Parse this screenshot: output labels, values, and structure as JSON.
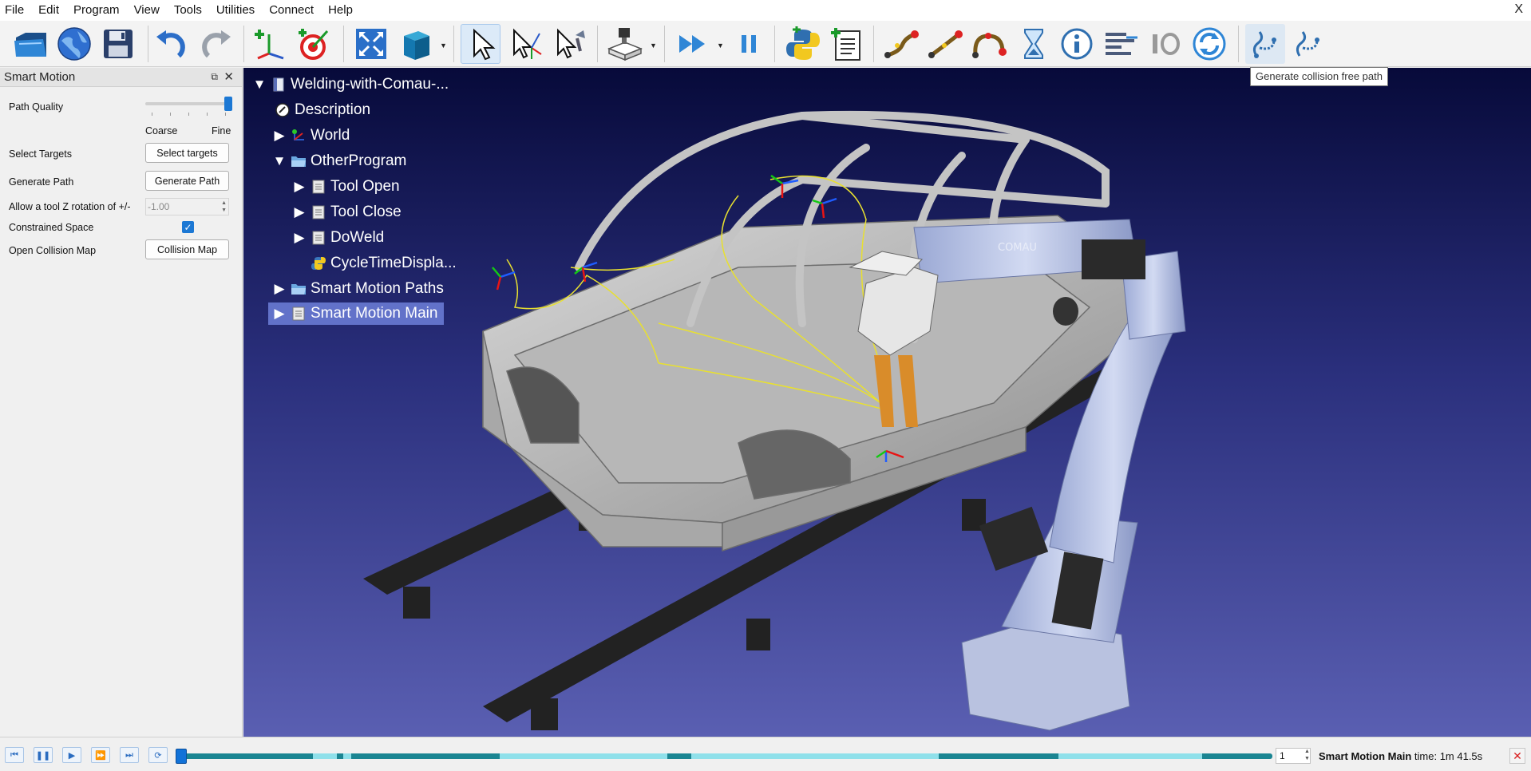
{
  "menu": [
    "File",
    "Edit",
    "Program",
    "View",
    "Tools",
    "Utilities",
    "Connect",
    "Help"
  ],
  "window_close": "X",
  "tooltip": "Generate collision free path",
  "panel": {
    "title": "Smart Motion",
    "path_quality_label": "Path Quality",
    "path_quality_value": 1.0,
    "coarse": "Coarse",
    "fine": "Fine",
    "select_targets_label": "Select Targets",
    "select_targets_btn": "Select targets",
    "generate_path_label": "Generate Path",
    "generate_path_btn": "Generate Path",
    "tool_z_label": "Allow a tool Z rotation of +/-",
    "tool_z_value": "-1.00",
    "constrained_label": "Constrained Space",
    "constrained_checked": true,
    "collision_map_label": "Open Collision Map",
    "collision_map_btn": "Collision Map"
  },
  "tree": [
    {
      "label": "Welding-with-Comau-...",
      "icon": "station-icon",
      "expanded": true
    },
    {
      "label": "Description",
      "icon": "description-icon"
    },
    {
      "label": "World",
      "icon": "world-frame-icon",
      "expanded": false
    },
    {
      "label": "OtherProgram",
      "icon": "folder-open-icon",
      "expanded": true
    },
    {
      "label": "Tool Open",
      "icon": "program-icon",
      "expanded": false
    },
    {
      "label": "Tool Close",
      "icon": "program-icon",
      "expanded": false
    },
    {
      "label": "DoWeld",
      "icon": "program-icon",
      "expanded": false
    },
    {
      "label": "CycleTimeDispla...",
      "icon": "python-icon"
    },
    {
      "label": "Smart Motion Paths",
      "icon": "folder-icon",
      "expanded": false
    },
    {
      "label": "Smart Motion Main",
      "icon": "program-icon",
      "expanded": false,
      "selected": true
    }
  ],
  "scene": {
    "robot_brand": "COMAU"
  },
  "playback": {
    "frame": "1",
    "program_name": "Smart Motion Main",
    "time_text": "time: 1m 41.5s"
  },
  "colors": {
    "accent": "#1c78d4",
    "tree_selected": "#6272c9",
    "timeline": "#1a8592",
    "timeline_light": "#8fe0ea"
  }
}
